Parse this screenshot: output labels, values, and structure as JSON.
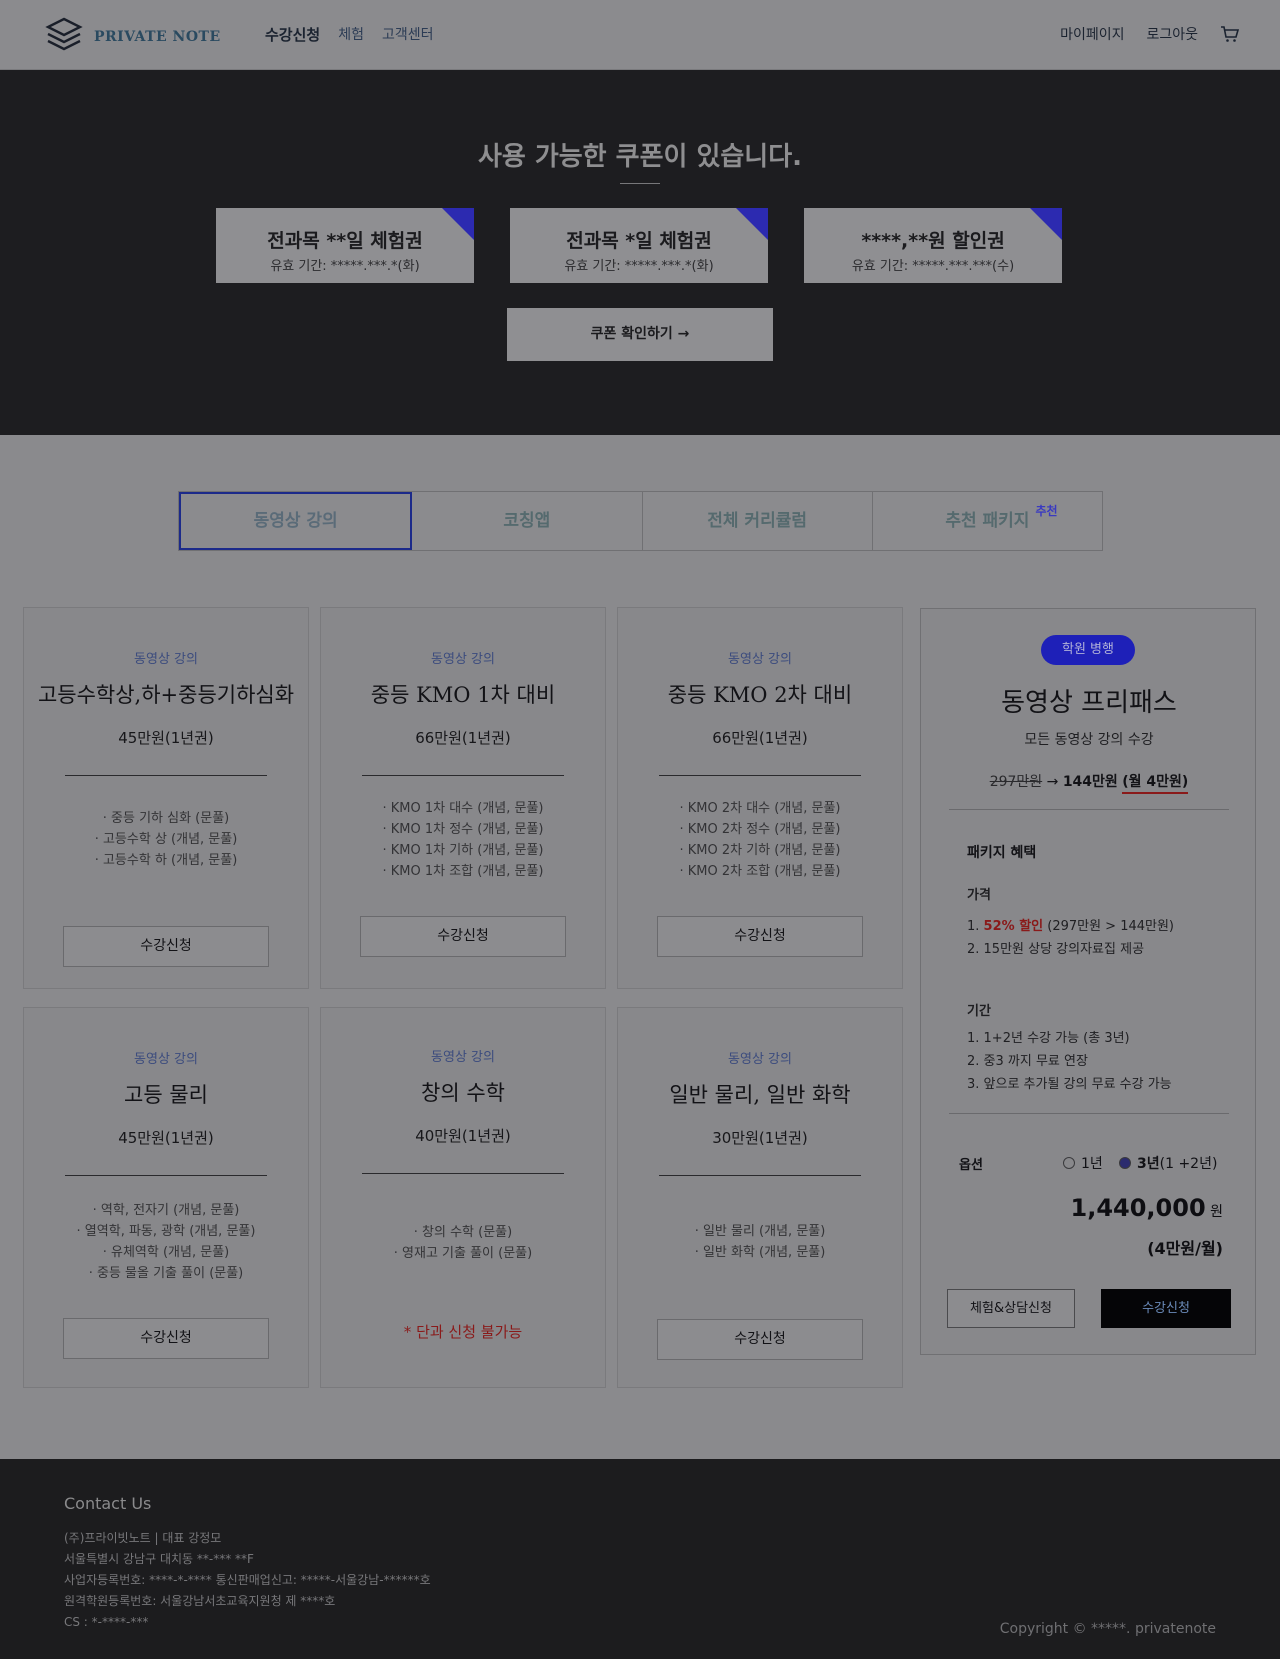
{
  "header": {
    "logo_text": "PRIVATE NOTE",
    "nav": [
      "수강신청",
      "체험",
      "고객센터"
    ],
    "mypage": "마이페이지",
    "logout": "로그아웃"
  },
  "hero": {
    "title": "사용 가능한 쿠폰이 있습니다.",
    "coupons": [
      {
        "title": "전과목 **일 체험권",
        "validity": "유효 기간: *****.***.*(화)"
      },
      {
        "title": "전과목 *일 체험권",
        "validity": "유효 기간: *****.***.*(화)"
      },
      {
        "title": "****,**원 할인권",
        "validity": "유효 기간: *****.***.***(수)"
      }
    ],
    "coupon_button": "쿠폰 확인하기 →",
    "corner_color": "#2c2ab0"
  },
  "tabs": [
    {
      "label": "동영상 강의"
    },
    {
      "label": "코칭앱"
    },
    {
      "label": "전체 커리큘럼"
    },
    {
      "label": "추천 패키지",
      "badge": "추천"
    }
  ],
  "cards": [
    {
      "category": "동영상 강의",
      "title": "고등수학상,하+중등기하심화",
      "price": "45만원(1년권)",
      "items": [
        "· 중등 기하 심화 (문풀)",
        "· 고등수학 상 (개념, 문풀)",
        "· 고등수학 하 (개념, 문풀)"
      ],
      "button": "수강신청"
    },
    {
      "category": "동영상 강의",
      "title": "중등 KMO 1차 대비",
      "price": "66만원(1년권)",
      "items": [
        "· KMO 1차 대수 (개념, 문풀)",
        "· KMO 1차 정수 (개념, 문풀)",
        "· KMO 1차 기하 (개념, 문풀)",
        "· KMO 1차 조합 (개념, 문풀)"
      ],
      "button": "수강신청"
    },
    {
      "category": "동영상 강의",
      "title": "중등 KMO 2차 대비",
      "price": "66만원(1년권)",
      "items": [
        "· KMO 2차 대수 (개념, 문풀)",
        "· KMO 2차 정수 (개념, 문풀)",
        "· KMO 2차 기하 (개념, 문풀)",
        "· KMO 2차 조합 (개념, 문풀)"
      ],
      "button": "수강신청"
    },
    {
      "category": "동영상 강의",
      "title": "고등 물리",
      "price": "45만원(1년권)",
      "items": [
        "· 역학, 전자기 (개념, 문풀)",
        "· 열역학, 파동, 광학 (개념, 문풀)",
        "· 유체역학 (개념, 문풀)",
        "· 중등 물올 기출 풀이 (문풀)"
      ],
      "button": "수강신청"
    },
    {
      "category": "동영상 강의",
      "title": "창의 수학",
      "price": "40만원(1년권)",
      "items": [
        "· 창의 수학 (문풀)",
        "· 영재고 기출 풀이 (문풀)"
      ],
      "note": "* 단과 신청 불가능"
    },
    {
      "category": "동영상 강의",
      "title": "일반 물리, 일반 화학",
      "price": "30만원(1년권)",
      "items": [
        "· 일반 물리 (개념, 문풀)",
        "· 일반 화학 (개념, 문풀)"
      ],
      "button": "수강신청"
    }
  ],
  "package": {
    "badge": "학원 병행",
    "title": "동영상 프리패스",
    "subtitle": "모든 동영상 강의 수강",
    "old_price": "297만원",
    "arrow": " → ",
    "new_price": "144만원",
    "monthly": "(월 4만원)",
    "benefits_title": "패키지 혜택",
    "price_heading": "가격",
    "price_item1_prefix": "1. ",
    "price_item1_highlight": "52% 할인",
    "price_item1_rest": " (297만원 > 144만원)",
    "price_item2": "2. 15만원 상당 강의자료집 제공",
    "period_heading": "기간",
    "period_items": [
      "1. 1+2년 수강 가능 (총 3년)",
      "2. 중3 까지 무료 연장",
      "3. 앞으로 추가될 강의 무료 수강 가능"
    ],
    "option_label": "옵션",
    "option1": "1년",
    "option2_main": "3년",
    "option2_sub": " (1 +2년)",
    "total": "1,440,000",
    "total_unit": " 원",
    "total_monthly": "(4만원/월)",
    "btn_consult": "체험&상담신청",
    "btn_enroll": "수강신청",
    "badge_color": "#1e20b8",
    "accent_red": "#8a1a1a"
  },
  "footer": {
    "title": "Contact Us",
    "lines": [
      "(주)프라이빗노트 | 대표 강정모",
      "서울특별시 강남구 대치동 **-*** **F",
      "사업자등록번호: ****-*-**** 통신판매업신고: *****-서울강남-******호",
      "원격학원등록번호: 서울강남서초교육지원청 제 ****호",
      "CS : *-****-***"
    ],
    "copyright": "Copyright © *****. privatenote"
  }
}
